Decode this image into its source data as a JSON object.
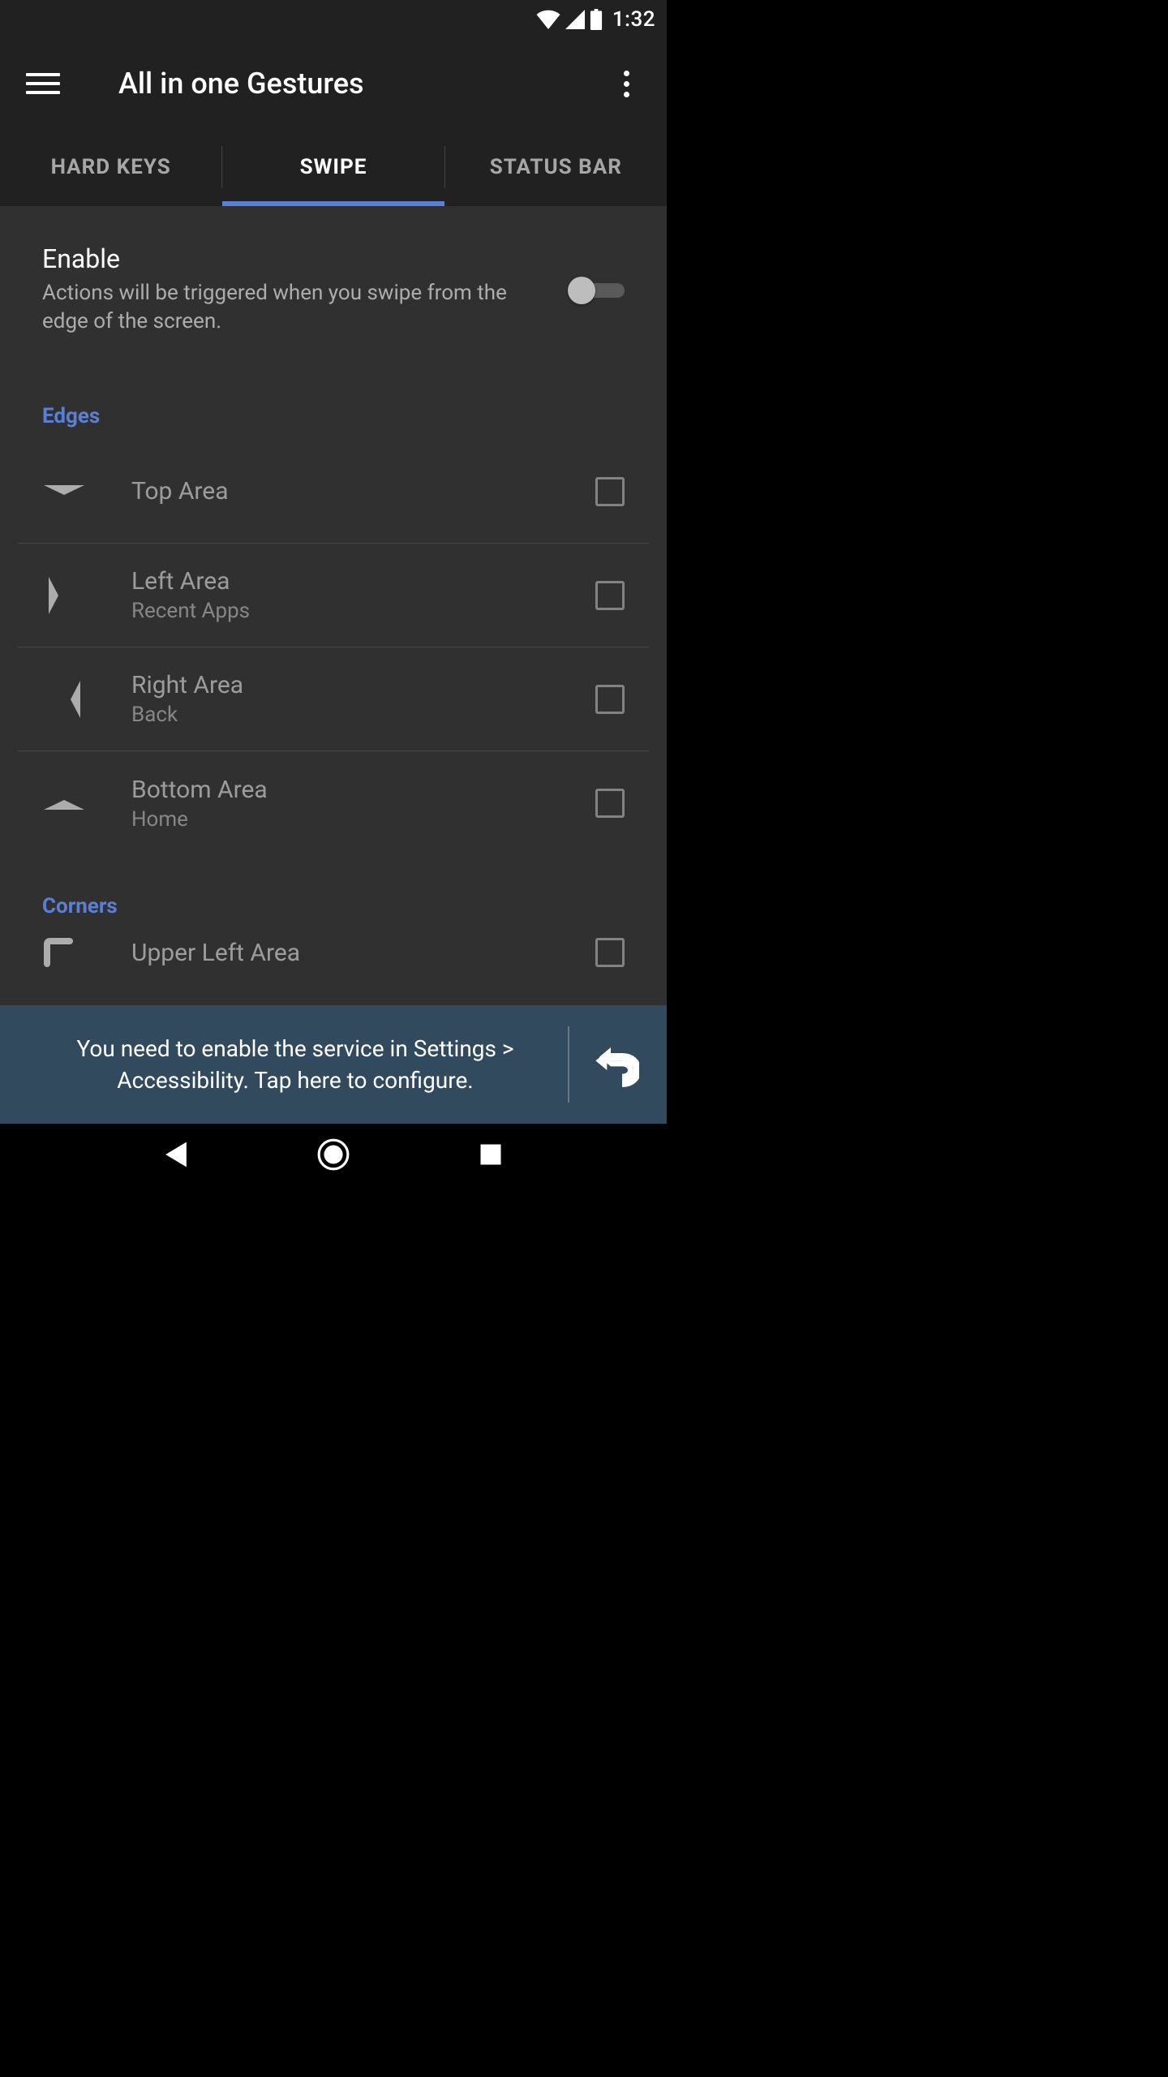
{
  "status": {
    "time": "1:32",
    "icons": [
      "wifi-icon",
      "cellular-icon",
      "battery-icon"
    ]
  },
  "header": {
    "title": "All in one Gestures"
  },
  "tabs": [
    {
      "id": "hard-keys",
      "label": "HARD KEYS",
      "active": false
    },
    {
      "id": "swipe",
      "label": "SWIPE",
      "active": true
    },
    {
      "id": "status-bar",
      "label": "STATUS BAR",
      "active": false
    }
  ],
  "enable": {
    "title": "Enable",
    "description": "Actions will be triggered when you swipe from the edge of the screen.",
    "value": false
  },
  "section_edges": {
    "title": "Edges",
    "items": [
      {
        "icon": "arrow-down-wide-icon",
        "title": "Top Area",
        "subtitle": "",
        "checked": false
      },
      {
        "icon": "arrow-right-icon",
        "title": "Left Area",
        "subtitle": "Recent Apps",
        "checked": false
      },
      {
        "icon": "arrow-left-icon",
        "title": "Right Area",
        "subtitle": "Back",
        "checked": false
      },
      {
        "icon": "arrow-up-wide-icon",
        "title": "Bottom Area",
        "subtitle": "Home",
        "checked": false
      }
    ]
  },
  "section_corners": {
    "title": "Corners",
    "items": [
      {
        "icon": "corner-upper-left-icon",
        "title": "Upper Left Area",
        "subtitle": "",
        "checked": false
      }
    ]
  },
  "snackbar": {
    "text": "You need to enable the service in Settings > Accessibility. Tap here to configure.",
    "action_icon": "undo-icon"
  },
  "colors": {
    "bg": "#303030",
    "bar": "#212121",
    "accent": "#5a7fd4",
    "snackbar": "#324a5e"
  }
}
